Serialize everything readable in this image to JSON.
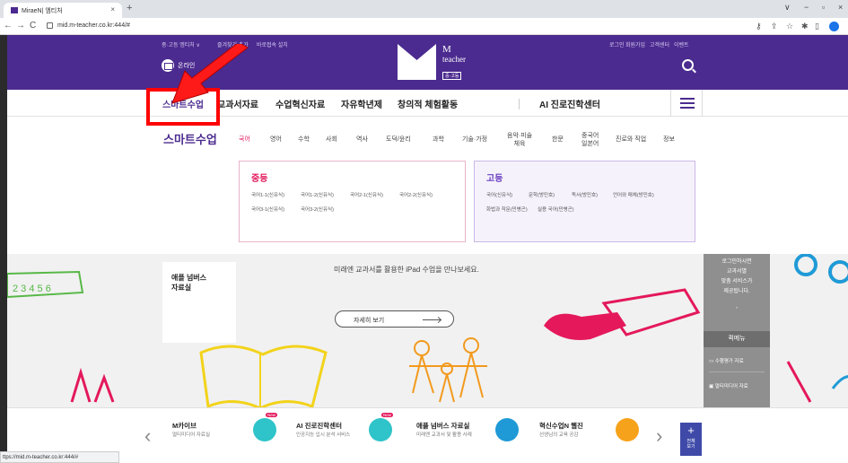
{
  "browser": {
    "tab_title": "MiraeN| 엠티처",
    "tab_close": "×",
    "new_tab": "+",
    "url": "mid.m-teacher.co.kr:444/#",
    "status_url": "ttps://mid.m-teacher.co.kr:444/#"
  },
  "header": {
    "util_left": [
      "중·고등 엠티처 ∨",
      "즐겨찾기 추가",
      "바로접속 설치"
    ],
    "util_right": [
      "로그인",
      "회원가입",
      "고객센터",
      "이벤트"
    ],
    "online_label": "온라인",
    "logo": {
      "m": "M",
      "teacher": "teacher",
      "sub": "중·고등"
    }
  },
  "gnb": {
    "items": [
      "스마트수업",
      "교과서자료",
      "수업혁신자료",
      "자유학년제",
      "창의적 체험활동"
    ],
    "career": "AI 진로진학센터"
  },
  "submenu": {
    "title": "스마트수업",
    "subjects": [
      "국어",
      "영어",
      "수학",
      "사회",
      "역사",
      "도덕/윤리",
      "과학",
      "기술·가정",
      "음악·미술\n체육",
      "한문",
      "중국어\n일본어",
      "진로와 직업",
      "정보"
    ],
    "middle": {
      "heading": "중등",
      "row1": [
        "국어1-1(신유식)",
        "국어1-2(신유식)",
        "국어2-1(신유식)",
        "국어2-2(신유식)"
      ],
      "row2": [
        "국어3-1(신유식)",
        "국어3-2(신유식)"
      ]
    },
    "high": {
      "heading": "고등",
      "row1": [
        "국어(신유식)",
        "문학(방민호)",
        "독서(방민호)",
        "언어와 매체(방민호)"
      ],
      "row2": [
        "화법과 작문(민병곤)",
        "실용 국어(민병곤)"
      ]
    }
  },
  "banner": {
    "card_title": "애플 넘버스\n자료실",
    "headline": "미래엔 교과서를 활용한 iPad 수업을 만나보세요.",
    "more_label": "자세히 보기"
  },
  "quick": {
    "login_msg": "로그인하시면\n교과서별\n맞춤 서비스가\n제공됩니다.",
    "quote": "”",
    "menu_label": "퀵메뉴",
    "links": [
      "수행평가 자료",
      "멀티미디어 자료"
    ]
  },
  "bottom": {
    "items": [
      {
        "title": "M카이브",
        "desc": "멀티미디어 자료실",
        "new": "New",
        "color": "#2ec4c9"
      },
      {
        "title": "AI 진로진학센터",
        "desc": "인공지능 입시 분석 서비스",
        "new": "New",
        "color": "#2ec4c9"
      },
      {
        "title": "애플 넘버스 자료실",
        "desc": "미래엔 교과서 및 활용 사례",
        "new": "",
        "color": "#1f9ad6"
      },
      {
        "title": "혁신수업N 웹진",
        "desc": "선생님의 교육 공감",
        "new": "",
        "color": "#f7a21b"
      }
    ],
    "all_label": "전체\n보기",
    "plus": "+"
  },
  "colors": {
    "brand": "#4b2b8f",
    "accent": "#e4185b",
    "highlight": "#ff0000"
  }
}
